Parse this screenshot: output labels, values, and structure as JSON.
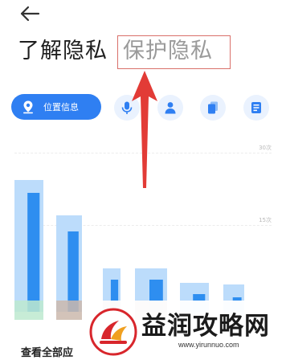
{
  "header": {
    "back_icon": "arrow-left-icon",
    "tabs": [
      {
        "label": "了解隐私",
        "active": true
      },
      {
        "label": "保护隐私",
        "active": false
      }
    ]
  },
  "permissions": {
    "selected": {
      "label": "位置信息",
      "icon": "location-pin-icon"
    },
    "others": [
      {
        "icon": "microphone-icon"
      },
      {
        "icon": "person-icon"
      },
      {
        "icon": "files-icon"
      },
      {
        "icon": "document-icon"
      }
    ]
  },
  "colors": {
    "accent": "#2f7ff2",
    "bar_light": "#bcdcfb",
    "bar_dark": "#2e8ef0",
    "bar_green": "#bde9cf",
    "bar_brown": "#cbb8ad",
    "annotation": "#e23b36"
  },
  "chart_data": {
    "type": "bar",
    "y_ticks": [
      "30次",
      "15次"
    ],
    "grid": true,
    "values_blurred": true
  },
  "footer": {
    "view_all_label": "查看全部应"
  },
  "watermark": {
    "title": "益润攻略网",
    "url": "www.yirunnuo.com"
  }
}
